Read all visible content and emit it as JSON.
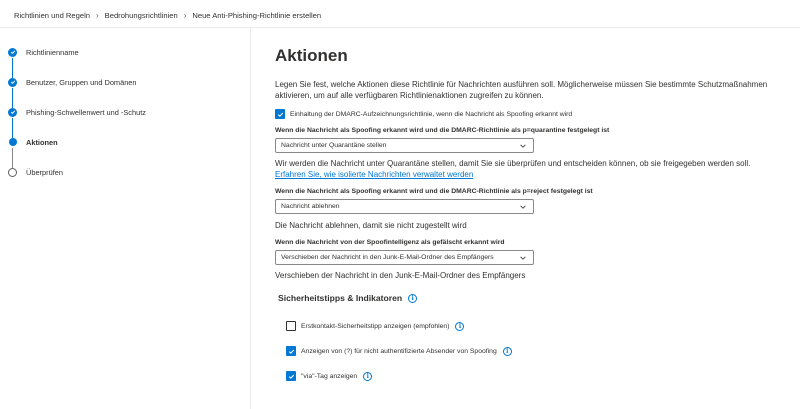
{
  "breadcrumb": {
    "items": [
      "Richtlinien und Regeln",
      "Bedrohungsrichtlinien",
      "Neue Anti-Phishing-Richtlinie erstellen"
    ]
  },
  "steps": [
    {
      "label": "Richtlinienname",
      "state": "done"
    },
    {
      "label": "Benutzer, Gruppen und Domänen",
      "state": "done"
    },
    {
      "label": "Phishing-Schwellenwert und -Schutz",
      "state": "done"
    },
    {
      "label": "Aktionen",
      "state": "current"
    },
    {
      "label": "Überprüfen",
      "state": "pending"
    }
  ],
  "main": {
    "title": "Aktionen",
    "description": "Legen Sie fest, welche Aktionen diese Richtlinie für Nachrichten ausführen soll. Möglicherweise müssen Sie bestimmte Schutzmaßnahmen aktivieren, um auf alle verfügbaren Richtlinienaktionen zugreifen zu können.",
    "dmarc_checkbox": {
      "label": "Einhaltung der DMARC-Aufzeichnungsrichtlinie, wenn die Nachricht als Spoofing erkannt wird",
      "checked": true
    },
    "quarantine": {
      "label": "Wenn die Nachricht als Spoofing erkannt wird und die DMARC-Richtlinie als p=quarantine festgelegt ist",
      "value": "Nachricht unter Quarantäne stellen",
      "help": "Wir werden die Nachricht unter Quarantäne stellen, damit Sie sie überprüfen und entscheiden können, ob sie freigegeben werden soll.",
      "link": "Erfahren Sie, wie isolierte Nachrichten verwaltet werden"
    },
    "reject": {
      "label": "Wenn die Nachricht als Spoofing erkannt wird und die DMARC-Richtlinie als p=reject festgelegt ist",
      "value": "Nachricht ablehnen",
      "help": "Die Nachricht ablehnen, damit sie nicht zugestellt wird"
    },
    "spoof": {
      "label": "Wenn die Nachricht von der Spoofintelligenz als gefälscht erkannt wird",
      "value": "Verschieben der Nachricht in den Junk-E-Mail-Ordner des Empfängers",
      "help": "Verschieben der Nachricht in den Junk-E-Mail-Ordner des Empfängers"
    },
    "tips_section": {
      "title": "Sicherheitstipps & Indikatoren",
      "items": [
        {
          "label": "Erstkontakt-Sicherheitstipp anzeigen (empfohlen)",
          "checked": false
        },
        {
          "label": "Anzeigen von (?) für nicht authentifizierte Absender von Spoofing",
          "checked": true
        },
        {
          "label": "\"via\"-Tag anzeigen",
          "checked": true
        }
      ]
    }
  },
  "colors": {
    "accent": "#0078d4",
    "text": "#323130",
    "border": "#8a8886"
  }
}
